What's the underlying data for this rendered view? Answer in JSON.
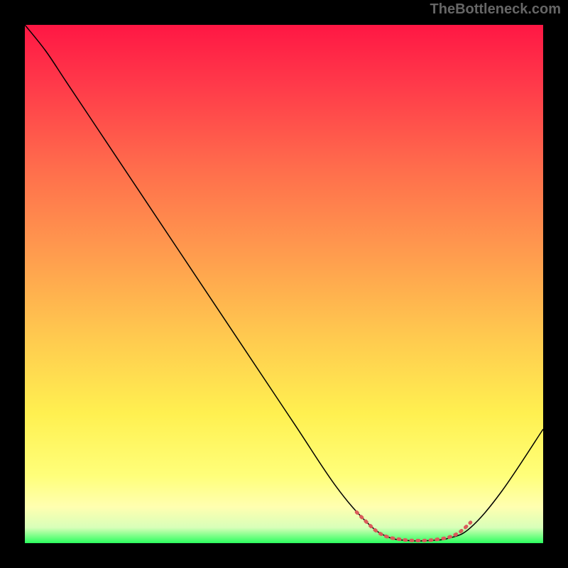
{
  "watermark": "TheBottleneck.com",
  "chart_data": {
    "type": "line",
    "title": "",
    "xlabel": "",
    "ylabel": "",
    "xlim": [
      0,
      100
    ],
    "ylim": [
      0,
      100
    ],
    "background": {
      "type": "vertical-gradient",
      "stops": [
        {
          "offset": 0.0,
          "color": "#ff1744"
        },
        {
          "offset": 0.12,
          "color": "#ff3b4a"
        },
        {
          "offset": 0.28,
          "color": "#ff6e4c"
        },
        {
          "offset": 0.45,
          "color": "#ff9e4e"
        },
        {
          "offset": 0.6,
          "color": "#ffc94f"
        },
        {
          "offset": 0.75,
          "color": "#fff050"
        },
        {
          "offset": 0.87,
          "color": "#ffff7a"
        },
        {
          "offset": 0.93,
          "color": "#ffffb0"
        },
        {
          "offset": 0.97,
          "color": "#d8ffb9"
        },
        {
          "offset": 1.0,
          "color": "#2bff5e"
        }
      ]
    },
    "series": [
      {
        "name": "bottleneck-curve",
        "stroke": "#000000",
        "stroke_width": 1.5,
        "points": [
          {
            "x": 0,
            "y": 100
          },
          {
            "x": 4,
            "y": 95
          },
          {
            "x": 8,
            "y": 89
          },
          {
            "x": 14,
            "y": 80
          },
          {
            "x": 22,
            "y": 68
          },
          {
            "x": 32,
            "y": 53
          },
          {
            "x": 42,
            "y": 38
          },
          {
            "x": 52,
            "y": 23
          },
          {
            "x": 60,
            "y": 11
          },
          {
            "x": 66,
            "y": 4
          },
          {
            "x": 70,
            "y": 1.2
          },
          {
            "x": 74,
            "y": 0.5
          },
          {
            "x": 78,
            "y": 0.5
          },
          {
            "x": 82,
            "y": 1.0
          },
          {
            "x": 86,
            "y": 3
          },
          {
            "x": 92,
            "y": 10
          },
          {
            "x": 100,
            "y": 22
          }
        ]
      },
      {
        "name": "optimal-range-marker",
        "stroke": "#d95b5b",
        "stroke_width": 5,
        "dash": "2 7",
        "points": [
          {
            "x": 64,
            "y": 6
          },
          {
            "x": 66,
            "y": 4
          },
          {
            "x": 68,
            "y": 2.2
          },
          {
            "x": 70,
            "y": 1.2
          },
          {
            "x": 72,
            "y": 0.8
          },
          {
            "x": 74,
            "y": 0.55
          },
          {
            "x": 76,
            "y": 0.5
          },
          {
            "x": 78,
            "y": 0.55
          },
          {
            "x": 80,
            "y": 0.8
          },
          {
            "x": 82,
            "y": 1.2
          },
          {
            "x": 84,
            "y": 2.2
          },
          {
            "x": 86,
            "y": 4
          }
        ]
      }
    ]
  }
}
